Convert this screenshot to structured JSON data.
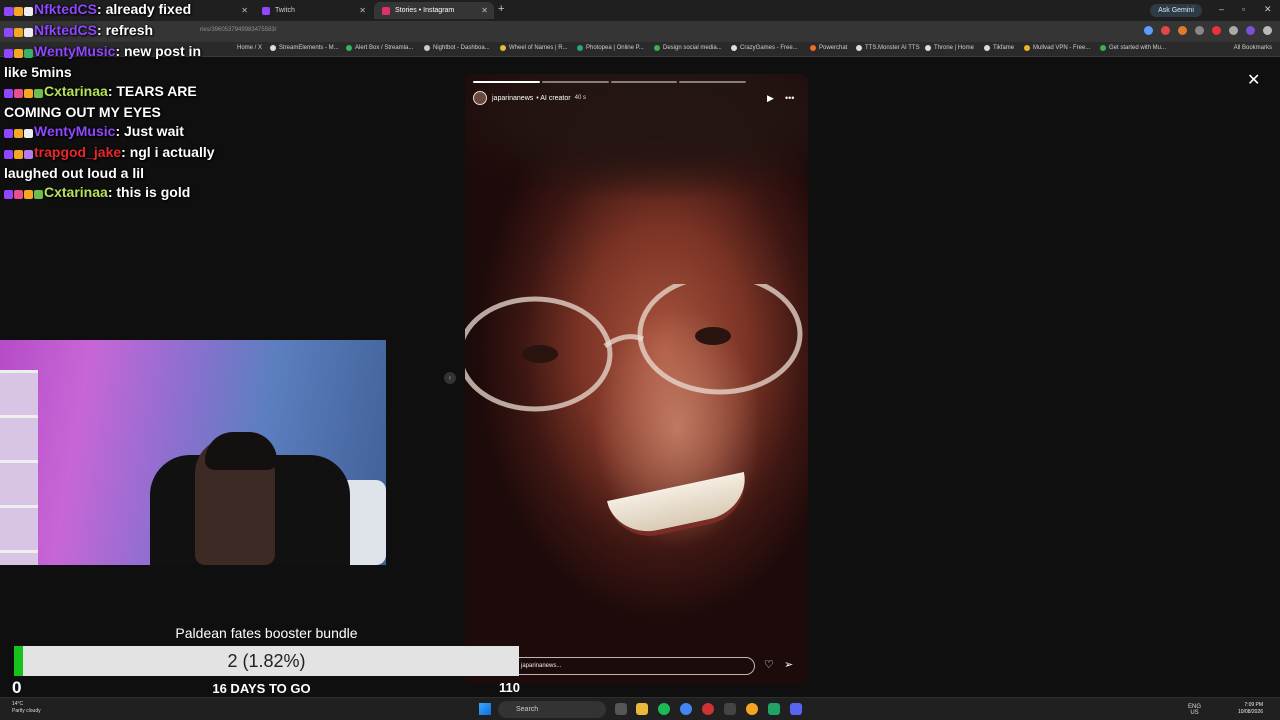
{
  "browser": {
    "tabs": [
      {
        "title": "",
        "active": false
      },
      {
        "title": "Twitch",
        "active": false
      },
      {
        "title": "Stories • Instagram",
        "active": true
      }
    ],
    "new_tab": "+",
    "ask_gemini": "Ask Gemini",
    "url": "ries/3960537949983475583/",
    "all_bookmarks": "All Bookmarks",
    "bookmarks": [
      "Home / X",
      "StreamElements - M...",
      "Alert Box / Streamla...",
      "Nightbot - Dashboa...",
      "Wheel of Names | R...",
      "Photopea | Online P...",
      "Design social media...",
      "CrazyGames - Free...",
      "Powerchat",
      "TTS.Monster AI TTS",
      "Throne | Home",
      "Tikfame",
      "Mullvad VPN - Free...",
      "Get started with Mu..."
    ]
  },
  "chat": {
    "messages": [
      {
        "user": "NfktedCS",
        "text": "already fixed",
        "color": "#9147ff"
      },
      {
        "user": "NfktedCS",
        "text": "refresh",
        "color": "#9147ff"
      },
      {
        "user": "WentyMusic",
        "text": "new post in",
        "color": "#9147ff"
      },
      {
        "user": "",
        "text": "like 5mins",
        "color": "#ffffff"
      },
      {
        "user": "Cxtarinaa",
        "text": "TEARS ARE",
        "color": "#b7e35a"
      },
      {
        "user": "",
        "text": "COMING OUT MY EYES",
        "color": "#ffffff"
      },
      {
        "user": "WentyMusic",
        "text": "Just wait",
        "color": "#9147ff"
      },
      {
        "user": "trapgod_jake",
        "text": "ngl i actually",
        "color": "#e8272c"
      },
      {
        "user": "",
        "text": "laughed out loud a lil",
        "color": "#ffffff"
      },
      {
        "user": "Cxtarinaa",
        "text": "this is gold",
        "color": "#b7e35a"
      }
    ]
  },
  "story": {
    "username": "japarinanews",
    "label": "• AI creator",
    "age": "40 s",
    "reply_placeholder": "japarinanews...",
    "progress_segments": 4,
    "progress_done": 1
  },
  "goal": {
    "title": "Paldean fates booster bundle",
    "current": 2,
    "display": "2 (1.82%)",
    "percent": 1.82,
    "min": "0",
    "max": "110",
    "days_left": "16 DAYS TO GO",
    "fill_color": "#17c21a"
  },
  "taskbar": {
    "weather_temp": "14°C",
    "weather_desc": "Partly cloudy",
    "search_placeholder": "Search",
    "lang": "ENG",
    "region": "US",
    "time": "7:09 PM",
    "date": "10/08/2026"
  }
}
